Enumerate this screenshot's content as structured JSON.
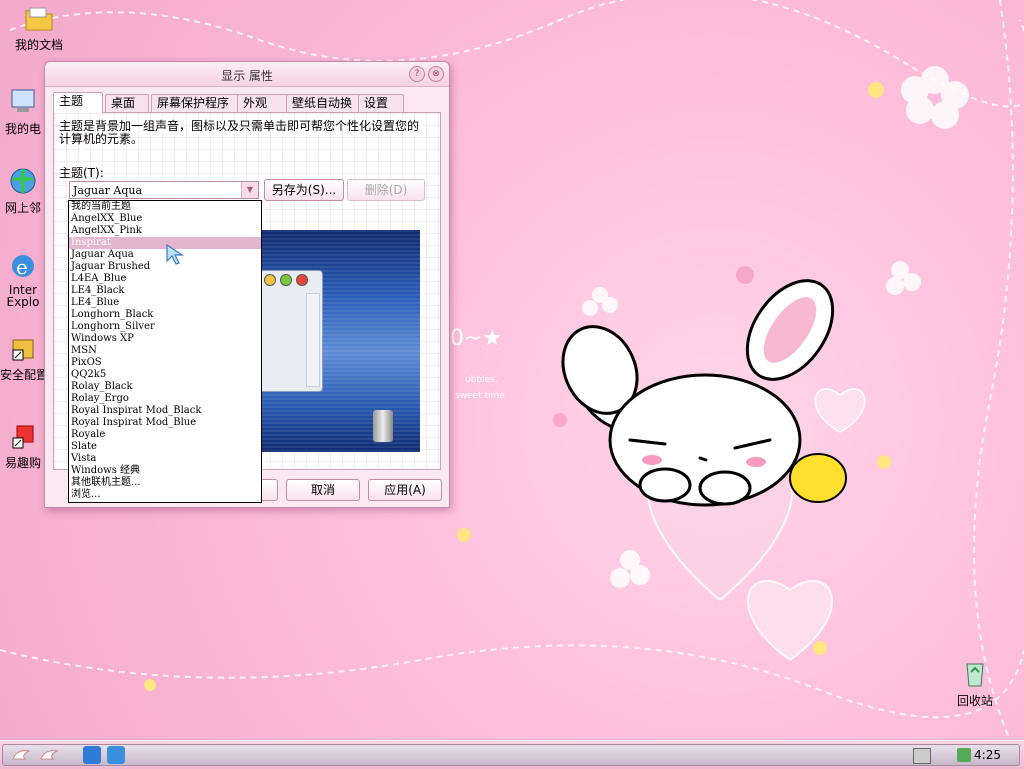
{
  "desktop_icons": [
    {
      "label": "我的文档",
      "icon": "folder-icon"
    },
    {
      "label": "我的电",
      "icon": "computer-icon"
    },
    {
      "label": "网上邻",
      "icon": "network-icon"
    },
    {
      "label": "Inter\nExplo",
      "icon": "ie-icon"
    },
    {
      "label": "安全配置",
      "icon": "security-icon"
    },
    {
      "label": "易趣购",
      "icon": "shortcut-icon"
    },
    {
      "label": "回收站",
      "icon": "recycle-bin-icon"
    }
  ],
  "window": {
    "title": "显示 属性",
    "help_glyph": "?",
    "close_glyph": "⊗",
    "tabs": [
      "主题",
      "桌面",
      "屏幕保护程序",
      "外观",
      "壁纸自动换",
      "设置"
    ],
    "description": "主题是背景加一组声音，图标以及只需单击即可帮您个性化设置您的计算机的元素。",
    "theme_label": "主题(T):",
    "theme_value": "Jaguar Aqua",
    "save_as_button": "另存为(S)...",
    "delete_button": "删除(D)",
    "cancel_button": "取消",
    "apply_button": "应用(A)"
  },
  "dropdown_items": [
    "我的当前主题",
    "AngelXX_Blue",
    "AngelXX_Pink",
    "Inspirat",
    "Jaguar Aqua",
    "Jaguar Brushed",
    "L4EA_Blue",
    "LE4_Black",
    "LE4_Blue",
    "Longhorn_Black",
    "Longhorn_Silver",
    "Windows XP",
    "MSN",
    "PixOS",
    "QQ2k5",
    "Rolay_Black",
    "Rolay_Ergo",
    "Royal Inspirat Mod_Black",
    "Royal Inspirat Mod_Blue",
    "Royale",
    "Slate",
    "Vista",
    "Windows 经典",
    "其他联机主题...",
    "浏览..."
  ],
  "dropdown_selected": "Inspirat",
  "wallpaper_text": "0~★",
  "wallpaper_subtext": [
    "ubbles.",
    "sweet time"
  ],
  "taskbar": {
    "clock": "4:25"
  },
  "colors": {
    "desktop_pink": "#f9b4d3",
    "selection": "#e3b5cf",
    "window_bg": "#fbe9f2"
  }
}
